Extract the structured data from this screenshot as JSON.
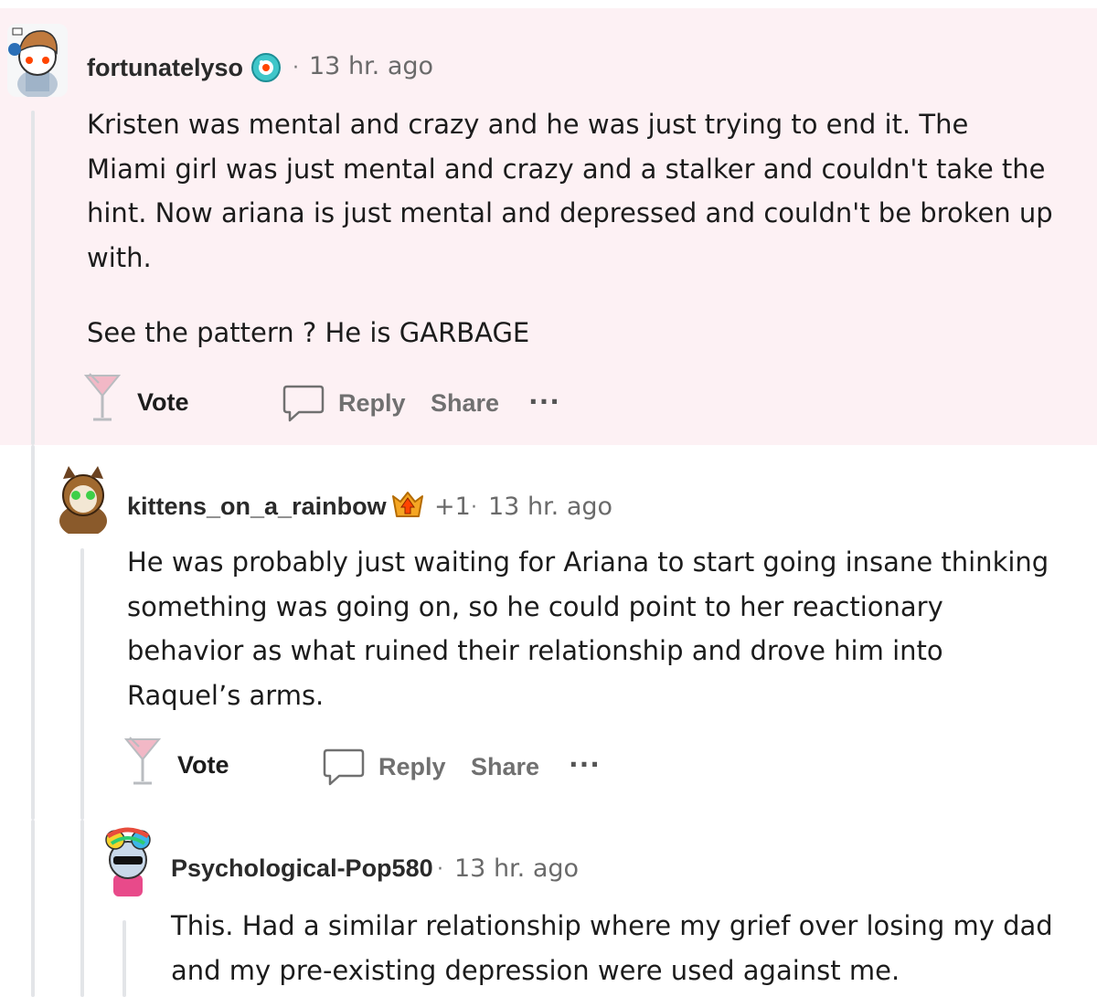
{
  "comments": [
    {
      "username": "fortunatelyso",
      "flair_icon": "snoo-orb-icon",
      "separator": "·",
      "time": "13 hr. ago",
      "paragraphs": [
        "Kristen was mental and crazy and he was just trying to end it. The Miami girl was just mental and crazy and a stalker and couldn't take the hint. Now ariana is just mental and depressed and couldn't be broken up with.",
        "See the pattern ? He is GARBAGE"
      ],
      "actions": {
        "vote": "Vote",
        "reply": "Reply",
        "share": "Share",
        "more": "···"
      }
    },
    {
      "username": "kittens_on_a_rainbow",
      "flair_icon": "top-contributor-badge-icon",
      "score": "+1",
      "separator": "·",
      "time": "13 hr. ago",
      "paragraphs": [
        "He was probably just waiting for Ariana to start going insane thinking something was going on, so he could point to her reactionary behavior as what ruined their relationship and drove him into Raquel’s arms."
      ],
      "actions": {
        "vote": "Vote",
        "reply": "Reply",
        "share": "Share",
        "more": "···"
      }
    },
    {
      "username": "Psychological-Pop580",
      "separator": "·",
      "time": "13 hr. ago",
      "paragraphs": [
        "This. Had a similar relationship where my grief over losing my dad and my pre-existing depression were used against me."
      ]
    }
  ],
  "colors": {
    "highlight_background": "#fdf1f4",
    "thread_line": "#e3e5e8",
    "vote_icon": "#f2b8c6"
  }
}
